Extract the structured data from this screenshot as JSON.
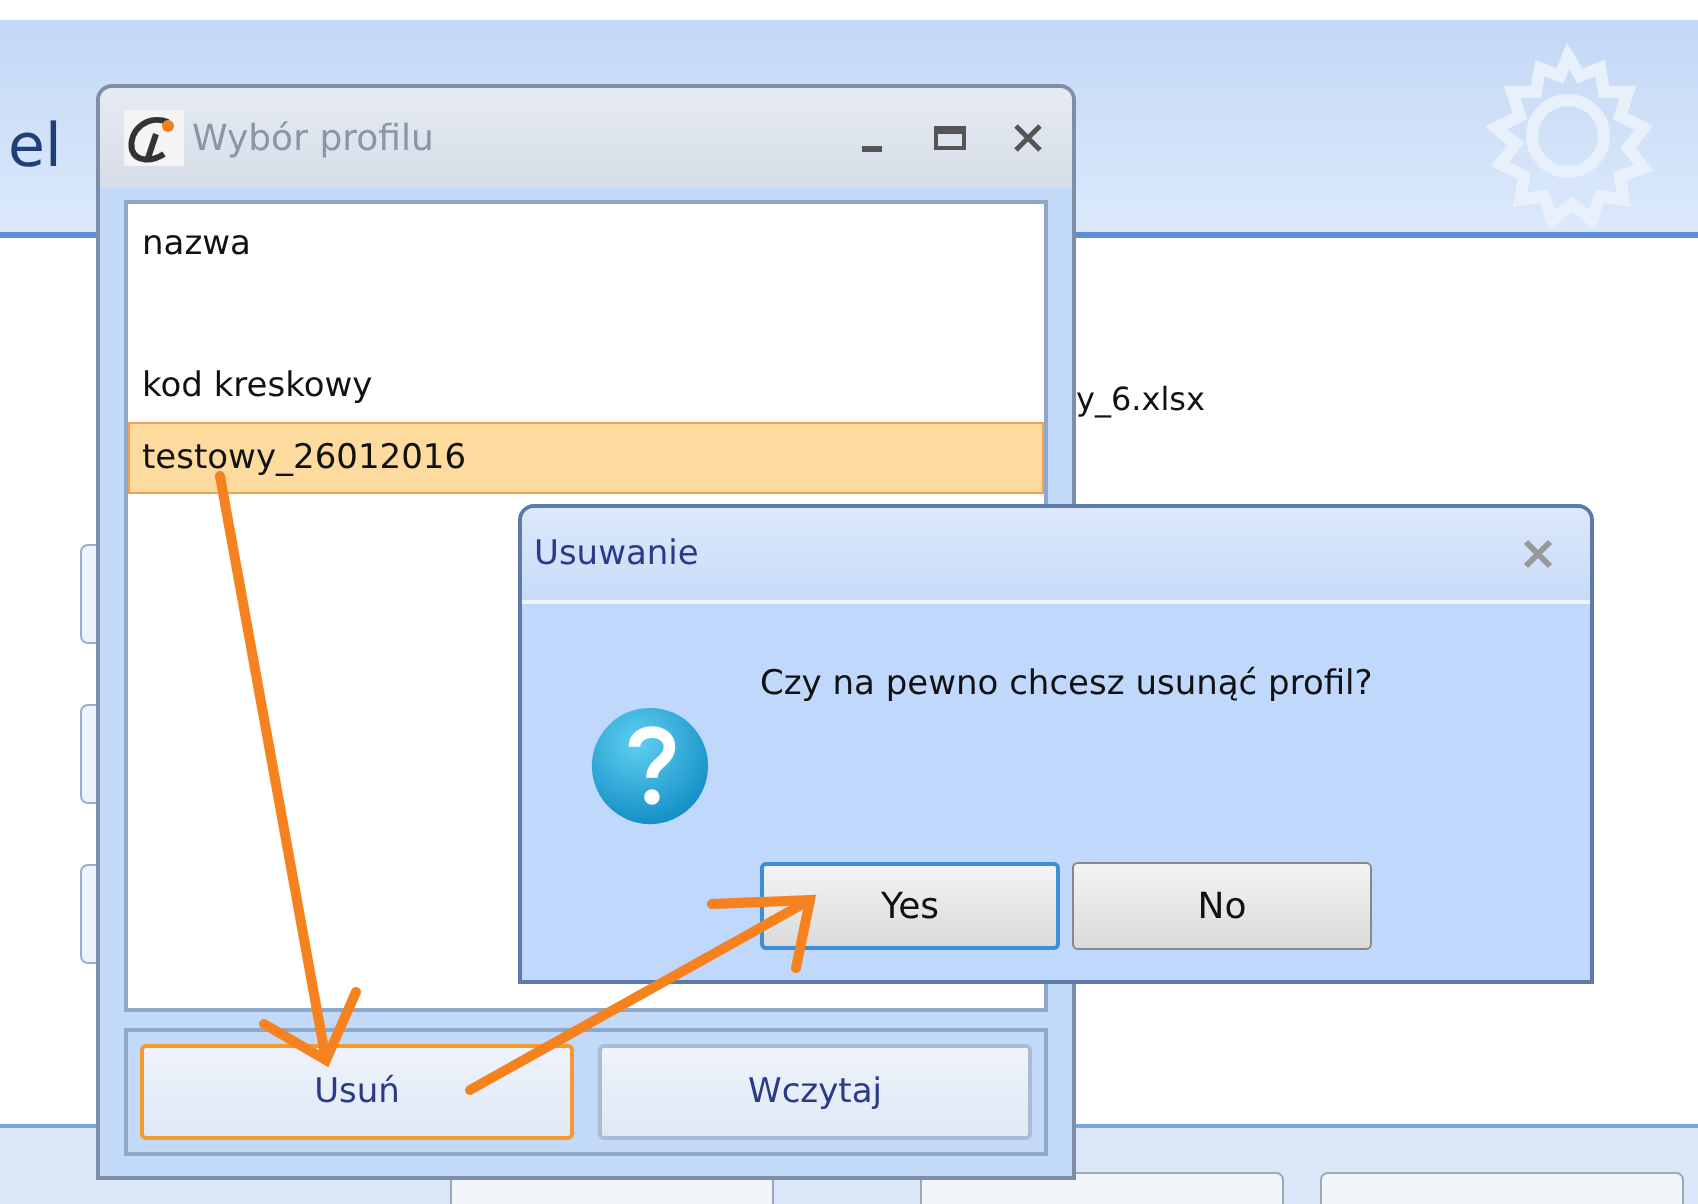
{
  "background_app": {
    "title_fragment": "el",
    "file_fragment": "y_6.xlsx"
  },
  "profile_window": {
    "title": "Wybór profilu",
    "items": [
      {
        "label": "nazwa",
        "selected": false
      },
      {
        "label": "kod kreskowy",
        "selected": false
      },
      {
        "label": "testowy_26012016",
        "selected": true
      }
    ],
    "buttons": [
      {
        "label": "Usuń",
        "focused": true
      },
      {
        "label": "Wczytaj",
        "focused": false
      }
    ]
  },
  "confirm_dialog": {
    "title": "Usuwanie",
    "message": "Czy na pewno chcesz usunąć profil?",
    "buttons": [
      {
        "label": "Yes",
        "default": true
      },
      {
        "label": "No",
        "default": false
      }
    ]
  }
}
